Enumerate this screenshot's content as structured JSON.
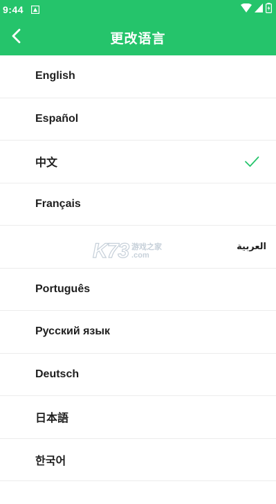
{
  "status_bar": {
    "time": "9:44",
    "notification_icon": "android-notification-icon",
    "wifi_icon": "wifi-icon",
    "signal_icon": "cell-signal-icon",
    "battery_icon": "battery-charging-icon"
  },
  "app_bar": {
    "title": "更改语言",
    "back_icon": "chevron-left-icon"
  },
  "languages": [
    {
      "label": "English",
      "selected": false
    },
    {
      "label": "Español",
      "selected": false
    },
    {
      "label": "中文",
      "selected": true
    },
    {
      "label": "Français",
      "selected": false
    },
    {
      "label": "العربية",
      "selected": false
    },
    {
      "label": "Português",
      "selected": false
    },
    {
      "label": "Русский язык",
      "selected": false
    },
    {
      "label": "Deutsch",
      "selected": false
    },
    {
      "label": "日本語",
      "selected": false
    },
    {
      "label": "한국어",
      "selected": false
    }
  ],
  "watermark": {
    "logo": "K73",
    "line1": "游戏之家",
    "line2": ".com"
  },
  "colors": {
    "accent": "#25c46b",
    "check": "#25c46b",
    "text": "#1e1e1e",
    "divider": "#ececec"
  }
}
